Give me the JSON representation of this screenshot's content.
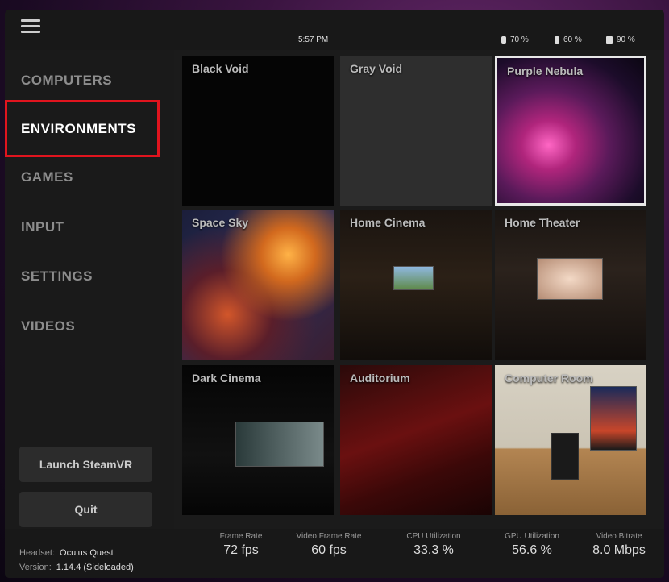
{
  "topbar": {
    "time": "5:57 PM",
    "batteries": [
      {
        "icon": "controller-battery-icon",
        "value": "70 %"
      },
      {
        "icon": "controller-battery-icon",
        "value": "60 %"
      },
      {
        "icon": "headset-battery-icon",
        "value": "90 %"
      }
    ]
  },
  "sidebar": {
    "items": [
      {
        "label": "COMPUTERS"
      },
      {
        "label": "ENVIRONMENTS"
      },
      {
        "label": "GAMES"
      },
      {
        "label": "INPUT"
      },
      {
        "label": "SETTINGS"
      },
      {
        "label": "VIDEOS"
      }
    ],
    "active": "ENVIRONMENTS",
    "launch_label": "Launch SteamVR",
    "quit_label": "Quit"
  },
  "environments": [
    {
      "label": "Black Void"
    },
    {
      "label": "Gray Void"
    },
    {
      "label": "Purple Nebula"
    },
    {
      "label": "Space Sky"
    },
    {
      "label": "Home Cinema"
    },
    {
      "label": "Home Theater"
    },
    {
      "label": "Dark Cinema"
    },
    {
      "label": "Auditorium"
    },
    {
      "label": "Computer Room"
    }
  ],
  "selected_environment": "Purple Nebula",
  "stats": {
    "frame_rate": {
      "label": "Frame Rate",
      "value": "72 fps"
    },
    "video_frame_rate": {
      "label": "Video Frame Rate",
      "value": "60 fps"
    },
    "cpu": {
      "label": "CPU Utilization",
      "value": "33.3 %"
    },
    "gpu": {
      "label": "GPU Utilization",
      "value": "56.6 %"
    },
    "bitrate": {
      "label": "Video Bitrate",
      "value": "8.0 Mbps"
    }
  },
  "device": {
    "headset_label": "Headset:",
    "headset_value": "Oculus Quest",
    "version_label": "Version:",
    "version_value": "1.14.4 (Sideloaded)"
  },
  "colors": {
    "highlight": "#e0141e",
    "selected_border": "#e8e8e8"
  }
}
